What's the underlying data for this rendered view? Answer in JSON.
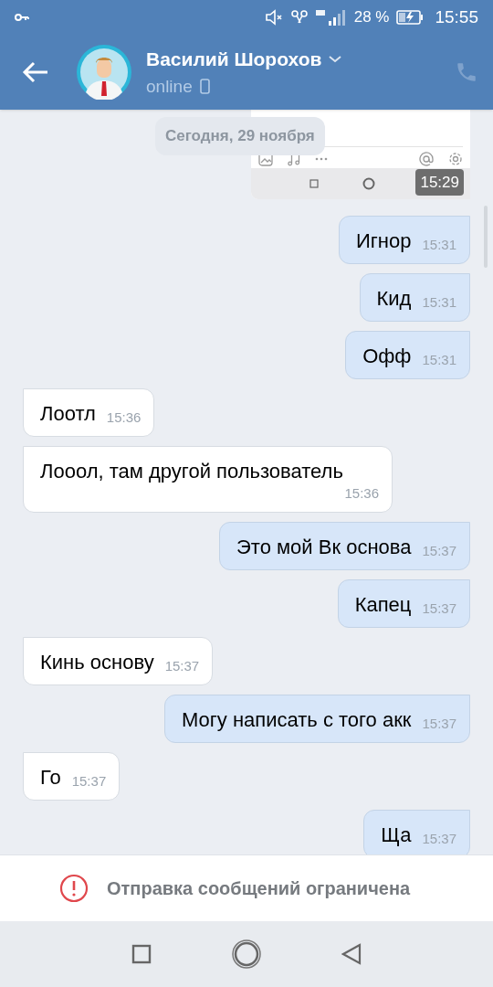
{
  "status_bar": {
    "battery": "28 %",
    "time": "15:55"
  },
  "header": {
    "title": "Василий Шорохов",
    "status": "online"
  },
  "date_separator": "Сегодня, 29 ноября",
  "messages": [
    {
      "kind": "screenshot",
      "outgoing": true,
      "time": "15:29"
    },
    {
      "kind": "text",
      "outgoing": true,
      "text": "Игнор",
      "time": "15:31"
    },
    {
      "kind": "text",
      "outgoing": true,
      "text": "Кид",
      "time": "15:31"
    },
    {
      "kind": "text",
      "outgoing": true,
      "text": "Офф",
      "time": "15:31"
    },
    {
      "kind": "text",
      "outgoing": false,
      "text": "Лоотл",
      "time": "15:36"
    },
    {
      "kind": "text",
      "outgoing": false,
      "text": "Лооол, там другой пользователь",
      "time": "15:36"
    },
    {
      "kind": "text",
      "outgoing": true,
      "text": "Это мой Вк основа",
      "time": "15:37"
    },
    {
      "kind": "text",
      "outgoing": true,
      "text": "Капец",
      "time": "15:37"
    },
    {
      "kind": "text",
      "outgoing": false,
      "text": "Кинь основу",
      "time": "15:37"
    },
    {
      "kind": "text",
      "outgoing": true,
      "text": "Могу написать с того акк",
      "time": "15:37"
    },
    {
      "kind": "text",
      "outgoing": false,
      "text": "Го",
      "time": "15:37"
    },
    {
      "kind": "text",
      "outgoing": true,
      "text": "Ща",
      "time": "15:37"
    }
  ],
  "restriction_notice": "Отправка сообщений ограничена"
}
